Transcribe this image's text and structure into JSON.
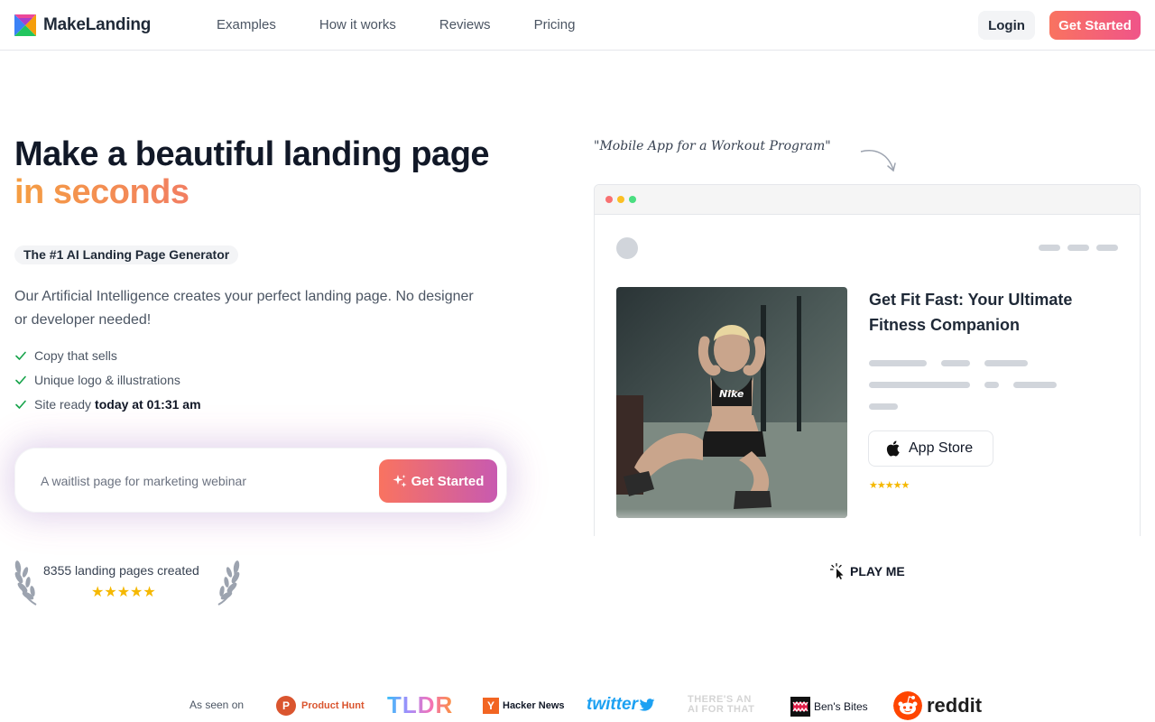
{
  "brand": {
    "name": "MakeLanding"
  },
  "nav": {
    "items": [
      "Examples",
      "How it works",
      "Reviews",
      "Pricing"
    ],
    "login_label": "Login",
    "cta_label": "Get Started"
  },
  "hero": {
    "title_line1": "Make a beautiful landing page",
    "title_line2": "in seconds",
    "badge": "The #1 AI Landing Page Generator",
    "description": "Our Artificial Intelligence creates your perfect landing page. No designer or developer needed!",
    "features": [
      {
        "text": "Copy that sells",
        "bold": ""
      },
      {
        "text": "Unique logo & illustrations",
        "bold": ""
      },
      {
        "text": "Site ready",
        "bold": "today at 01:31 am"
      }
    ],
    "prompt_placeholder": "A waitlist page for marketing webinar",
    "prompt_button": "Get Started",
    "counter_text": "8355 landing pages created",
    "counter_stars": "★★★★★"
  },
  "preview": {
    "handwritten_note": "\"Mobile App for a Workout Program\"",
    "card_title": "Get Fit Fast: Your Ultimate Fitness Companion",
    "app_store_label": "App Store",
    "stars": "★★★★★",
    "play_label": "PLAY ME"
  },
  "press": {
    "label": "As seen on",
    "product_hunt": "Product Hunt",
    "product_hunt_mark": "P",
    "tldr": "TLDR",
    "hacker_news_mark": "Y",
    "hacker_news": "Hacker News",
    "twitter": "twitter",
    "aiforthat_line1": "THERE'S AN",
    "aiforthat_line2": "AI FOR THAT",
    "bens_bites": "Ben's Bites",
    "reddit": "reddit"
  },
  "colors": {
    "accent_orange": "#f97360",
    "accent_pink": "#ec4899",
    "star": "#f5b800",
    "check": "#16a34a"
  }
}
